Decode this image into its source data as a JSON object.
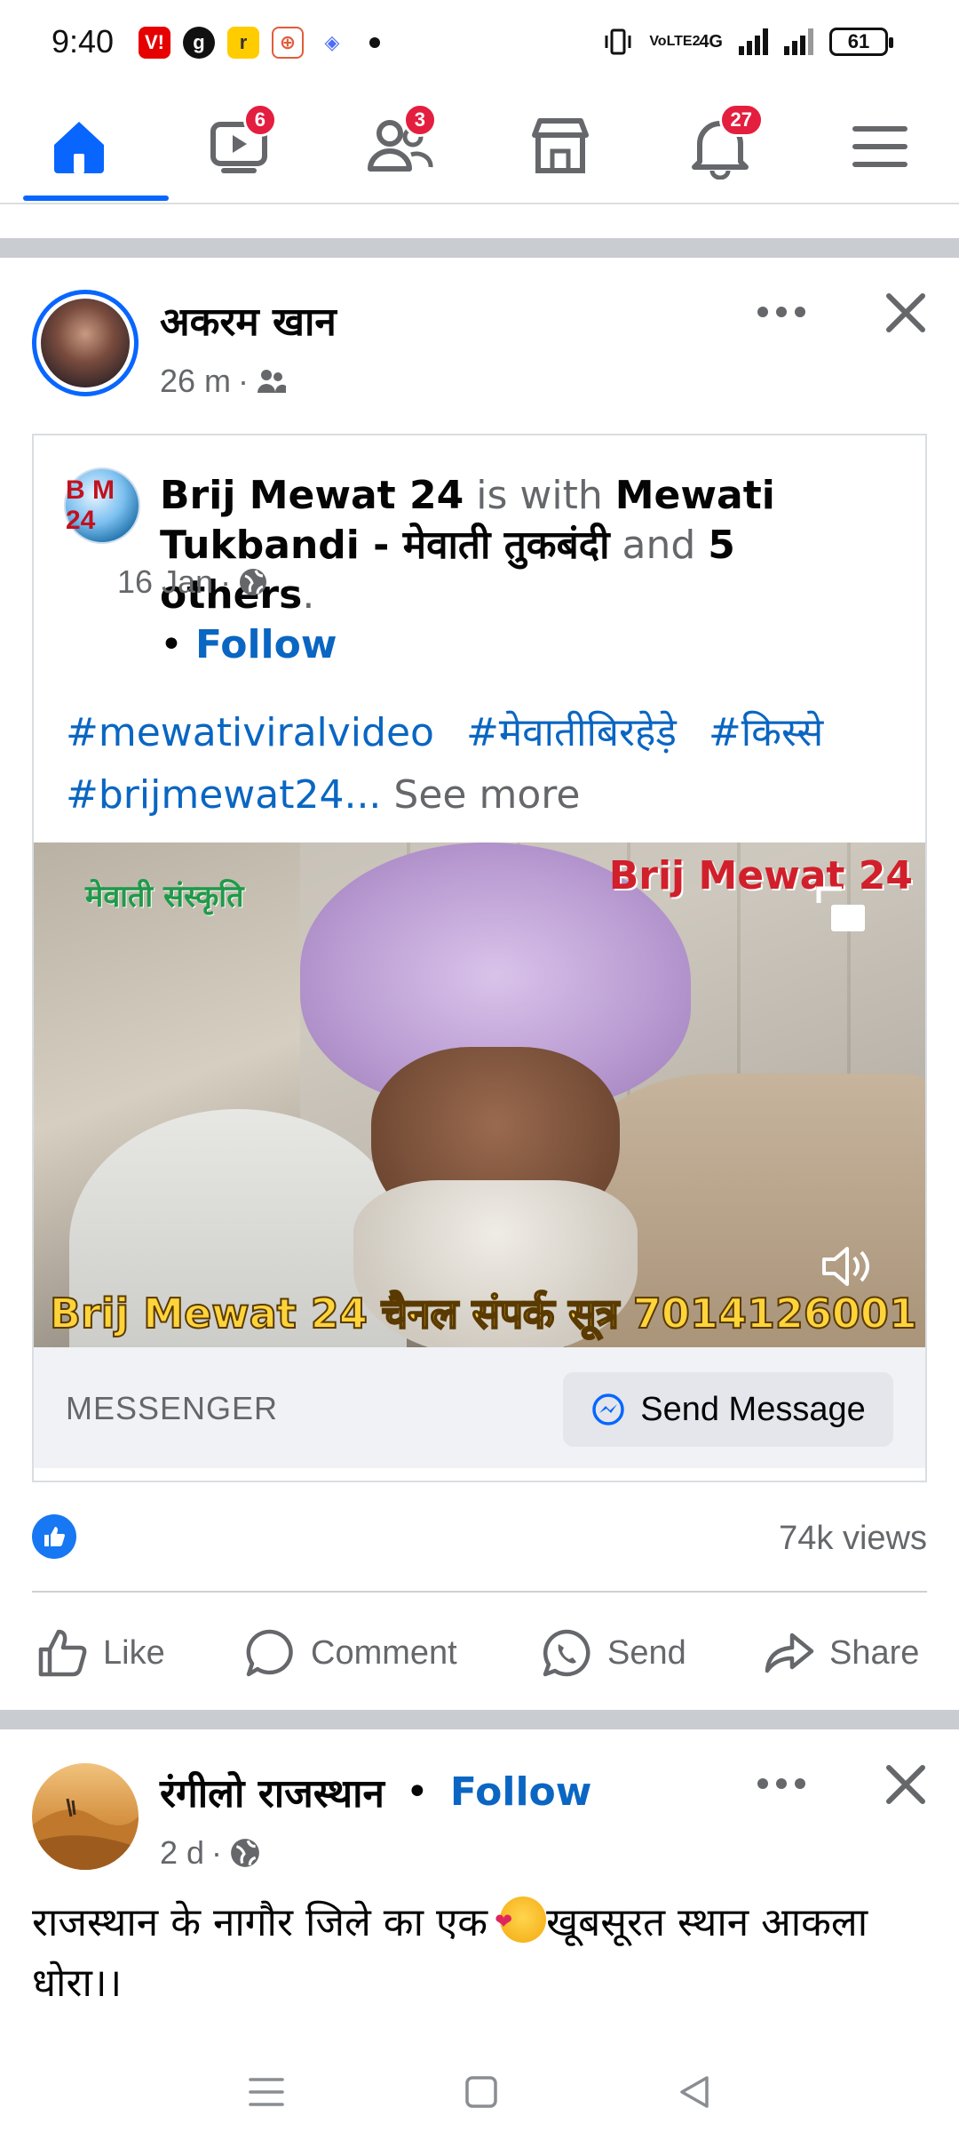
{
  "status_bar": {
    "time": "9:40",
    "network_label": "4G",
    "volte_label": "VoLTE2",
    "battery": "61",
    "app_icons": [
      {
        "name": "vi-icon",
        "glyph": "V!",
        "color": "#e60000"
      },
      {
        "name": "g-icon",
        "glyph": "g",
        "color": "#111111"
      },
      {
        "name": "realme-icon",
        "glyph": "r",
        "color": "#ffcc00"
      },
      {
        "name": "game-icon",
        "glyph": "⊕",
        "color": "#e25c3a"
      },
      {
        "name": "dice-icon",
        "glyph": "◈",
        "color": "#4b6cf7"
      }
    ]
  },
  "nav": {
    "watch_badge": "6",
    "friends_badge": "3",
    "notifications_badge": "27"
  },
  "post1": {
    "author": "अकरम खान",
    "time": "26 m",
    "audience": "friends-icon",
    "shared": {
      "page_logo_text": "B M 24",
      "page_name": "Brij Mewat 24",
      "is_with": "is with",
      "tagged": "Mewati Tukbandi - मेवाती तुकबंदी",
      "and": "and",
      "others": "5 others",
      "period": ".",
      "bullet": "•",
      "follow": "Follow",
      "date": "16 Jan",
      "hashtags": [
        "#mewativiralvideo",
        "#मेवातीबिरहेड़े",
        "#किस्से",
        "#brijmewat24..."
      ],
      "see_more": "See more",
      "video": {
        "overlay_left": "मेवाती संस्कृति",
        "overlay_right": "Brij Mewat 24",
        "caption": "Brij Mewat 24 चैनल संपर्क सूत्र 7014126001"
      },
      "messenger_label": "MESSENGER",
      "send_message": "Send Message"
    },
    "views": "74k views",
    "actions": {
      "like": "Like",
      "comment": "Comment",
      "send": "Send",
      "share": "Share"
    }
  },
  "post2": {
    "author": "रंगीलो राजस्थान",
    "bullet": "•",
    "follow": "Follow",
    "time": "2 d",
    "text_before": "राजस्थान के नागौर जिले का एक ",
    "text_after": "खूबसूरत स्थान आकला धोरा।।"
  },
  "colors": {
    "brand_blue": "#0866ff",
    "link_blue": "#0a66c2",
    "badge_red": "#e41e3f",
    "secondary_text": "#65676b"
  }
}
